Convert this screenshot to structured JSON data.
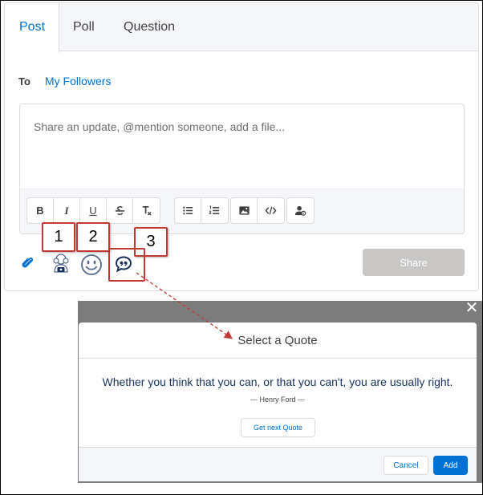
{
  "tabs": [
    {
      "label": "Post",
      "active": true
    },
    {
      "label": "Poll",
      "active": false
    },
    {
      "label": "Question",
      "active": false
    }
  ],
  "to": {
    "label": "To",
    "value": "My Followers"
  },
  "editor": {
    "placeholder": "Share an update, @mention someone, add a file..."
  },
  "toolbar": {
    "groups": [
      [
        "bold-icon",
        "italic-icon",
        "underline-icon",
        "strikethrough-icon",
        "clear-format-icon"
      ],
      [
        "bulleted-list-icon",
        "numbered-list-icon"
      ],
      [
        "image-icon",
        "code-icon"
      ],
      [
        "mention-user-icon"
      ]
    ],
    "bold": "B",
    "italic": "I",
    "underline": "U"
  },
  "actions": {
    "icons": [
      "attach-icon",
      "person-icon",
      "smiley-icon",
      "quote-icon"
    ],
    "share_label": "Share"
  },
  "callouts": [
    "1",
    "2",
    "3"
  ],
  "quote_modal": {
    "close": "✕",
    "title": "Select a Quote",
    "quote": "Whether you think that you can, or that you can't, you are usually right.",
    "author": "--- Henry Ford ---",
    "next_label": "Get next Quote",
    "cancel_label": "Cancel",
    "add_label": "Add"
  },
  "colors": {
    "accent": "#0070d2",
    "callout_border": "#c23934",
    "disabled_button": "#c9c7c5",
    "overlay": "#7c7c7c"
  }
}
